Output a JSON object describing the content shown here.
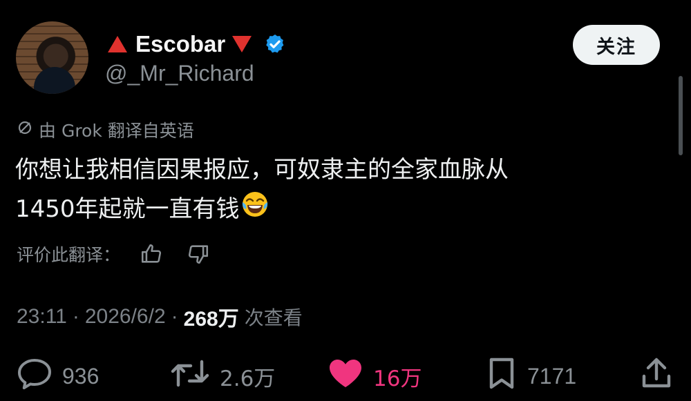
{
  "user": {
    "display_name": "Escobar",
    "handle": "@_Mr_Richard",
    "verified": true,
    "follow_label": "关注"
  },
  "translation": {
    "notice": "由 Grok 翻译自英语",
    "rate_label": "评价此翻译："
  },
  "tweet": {
    "text_line1": "你想让我相信因果报应，可奴隶主的全家血脉从",
    "text_line2": "1450年起就一直有钱",
    "emoji": "face-with-tears-of-joy"
  },
  "meta": {
    "time": "23:11",
    "date": "2026/6/2",
    "views_count": "268万",
    "views_label": "次查看",
    "separator": "·"
  },
  "actions": {
    "replies": "936",
    "retweets": "2.6万",
    "likes": "16万",
    "bookmarks": "7171"
  },
  "colors": {
    "background": "#000000",
    "text_primary": "#e7e9ea",
    "text_secondary": "#8b9196",
    "verified_blue": "#1d9bf0",
    "like_pink": "#f0357f",
    "red_triangle": "#e0322e",
    "follow_button_bg": "#eff3f4"
  }
}
